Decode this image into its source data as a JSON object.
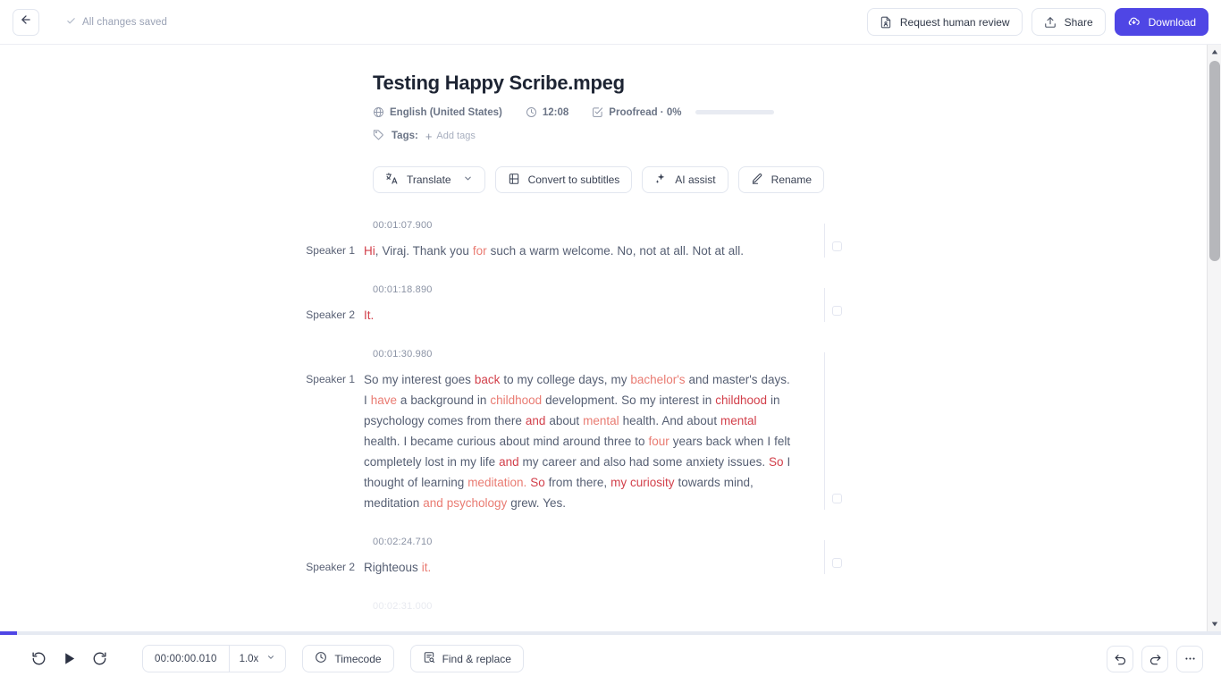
{
  "topbar": {
    "back_icon": "arrow-left-icon",
    "saved_status": "All changes saved",
    "saved_check_icon": "check-icon",
    "request_review_label": "Request human review",
    "share_label": "Share",
    "download_label": "Download",
    "primary_color": "#4f46e5"
  },
  "document": {
    "title": "Testing Happy Scribe.mpeg",
    "language": "English (United States)",
    "duration": "12:08",
    "proofread": "Proofread · 0%",
    "proofread_percent": 0,
    "tags_label": "Tags:",
    "add_tags_label": "Add tags"
  },
  "actions": [
    {
      "label": "Translate",
      "icon": "translate-icon",
      "has_chevron": true
    },
    {
      "label": "Convert to subtitles",
      "icon": "subtitles-icon",
      "has_chevron": false
    },
    {
      "label": "AI assist",
      "icon": "sparkles-icon",
      "has_chevron": false
    },
    {
      "label": "Rename",
      "icon": "pencil-icon",
      "has_chevron": false
    }
  ],
  "transcript": {
    "segments": [
      {
        "time": "00:01:07.900",
        "speaker": "Speaker 1",
        "tokens": [
          {
            "t": "Hi",
            "c": "lo"
          },
          {
            "t": ", Viraj. Thank you ",
            "c": ""
          },
          {
            "t": "for",
            "c": "mid"
          },
          {
            "t": " such a warm welcome. No, not at all. Not at all.",
            "c": ""
          }
        ]
      },
      {
        "time": "00:01:18.890",
        "speaker": "Speaker 2",
        "tokens": [
          {
            "t": "It.",
            "c": "lo"
          }
        ]
      },
      {
        "time": "00:01:30.980",
        "speaker": "Speaker 1",
        "tokens": [
          {
            "t": "So my interest goes ",
            "c": ""
          },
          {
            "t": "back",
            "c": "lo"
          },
          {
            "t": " to my college days, my ",
            "c": ""
          },
          {
            "t": "bachelor's",
            "c": "mid"
          },
          {
            "t": " and master's days. I ",
            "c": ""
          },
          {
            "t": "have",
            "c": "mid"
          },
          {
            "t": " a background in ",
            "c": ""
          },
          {
            "t": "childhood",
            "c": "mid"
          },
          {
            "t": " development. So my interest in ",
            "c": ""
          },
          {
            "t": "childhood",
            "c": "lo"
          },
          {
            "t": " in psychology comes from there ",
            "c": ""
          },
          {
            "t": "and",
            "c": "lo"
          },
          {
            "t": " about ",
            "c": ""
          },
          {
            "t": "mental",
            "c": "mid"
          },
          {
            "t": " health. And about ",
            "c": ""
          },
          {
            "t": "mental",
            "c": "lo"
          },
          {
            "t": " health. I became curious about mind around three to ",
            "c": ""
          },
          {
            "t": "four",
            "c": "mid"
          },
          {
            "t": " years back when I felt completely lost in my life ",
            "c": ""
          },
          {
            "t": "and",
            "c": "lo"
          },
          {
            "t": " my career and also had some anxiety issues. ",
            "c": ""
          },
          {
            "t": "So",
            "c": "lo"
          },
          {
            "t": " I thought of learning ",
            "c": ""
          },
          {
            "t": "meditation.",
            "c": "mid"
          },
          {
            "t": " ",
            "c": ""
          },
          {
            "t": "So",
            "c": "lo"
          },
          {
            "t": " from there, ",
            "c": ""
          },
          {
            "t": "my curiosity",
            "c": "lo"
          },
          {
            "t": " towards mind, meditation ",
            "c": ""
          },
          {
            "t": "and psychology",
            "c": "mid"
          },
          {
            "t": " grew. Yes.",
            "c": ""
          }
        ]
      },
      {
        "time": "00:02:24.710",
        "speaker": "Speaker 2",
        "tokens": [
          {
            "t": "Righteous ",
            "c": ""
          },
          {
            "t": "it.",
            "c": "mid"
          }
        ]
      }
    ],
    "partial_next_time": "00:02:31.000"
  },
  "player": {
    "rewind_icon": "rewind-icon",
    "play_icon": "play-icon",
    "forward_icon": "forward-icon",
    "current_time": "00:00:00.010",
    "speed": "1.0x",
    "timecode_label": "Timecode",
    "find_replace_label": "Find & replace",
    "undo_icon": "undo-icon",
    "redo_icon": "redo-icon",
    "more_icon": "more-icon",
    "progress_percent": 1.4
  },
  "scrollbar": {
    "up_icon": "caret-up-icon",
    "down_icon": "caret-down-icon"
  }
}
